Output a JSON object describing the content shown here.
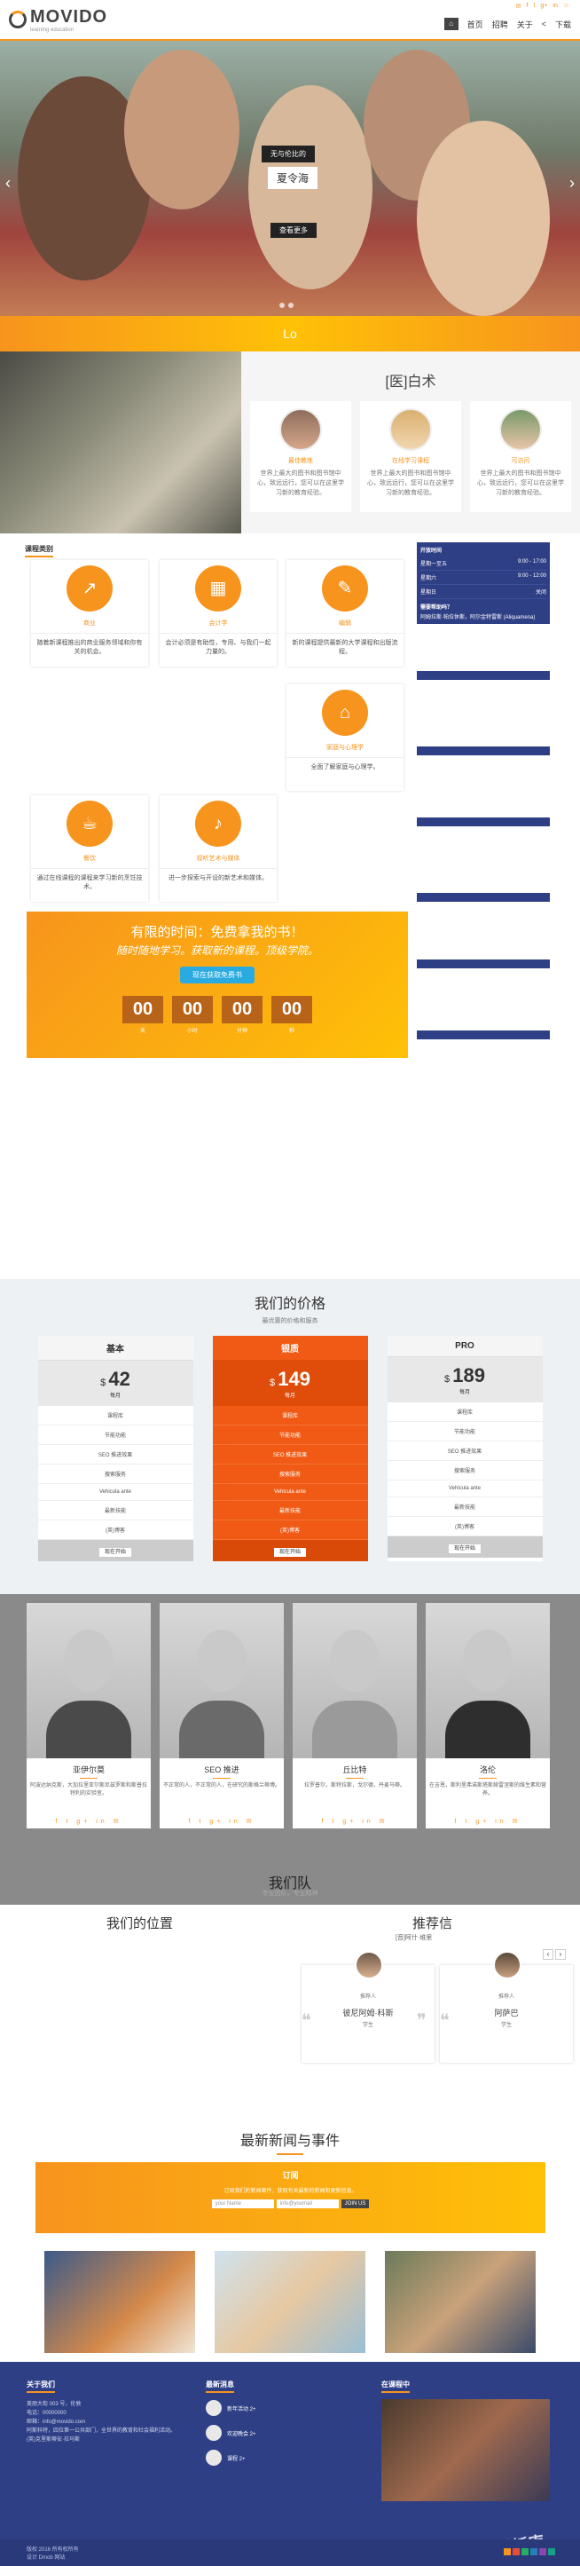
{
  "topbar": {
    "brand": "MOVIDO",
    "tagline": "learning education",
    "nav": [
      "首页",
      "招聘",
      "关于",
      "下载"
    ],
    "nav_home_glyph": "⌂",
    "nav_share_glyph": "<",
    "socials": [
      "✉",
      "f",
      "t",
      "g+",
      "in",
      "☺"
    ]
  },
  "hero": {
    "card": "无与伦比的",
    "title": "夏令海",
    "button": "查看更多",
    "prev": "‹",
    "next": "›"
  },
  "strip": {
    "text": "Lo"
  },
  "intro": {
    "title": "[医]白术",
    "features": [
      {
        "name": "最佳教练",
        "desc": "世界上最大的图书和图书馆中心，致远远行，您可以在这里学习新的教育经验。"
      },
      {
        "name": "在线学习课程",
        "desc": "世界上最大的图书和图书馆中心，致远远行，您可以在这里学习新的教育经验。"
      },
      {
        "name": "可访问",
        "desc": "世界上最大的图书和图书馆中心，致远远行，您可以在这里学习新的教育经验。"
      }
    ]
  },
  "courses": {
    "heading": "课程类别",
    "items": [
      {
        "title": "商业",
        "desc": "随着新课程推出的商业服务领域和你有关的机会。",
        "icon": "chart-icon",
        "glyph": "↗"
      },
      {
        "title": "会计学",
        "desc": "会计必须是有助性，专用、与我们一起力量的。",
        "icon": "calculator-icon",
        "glyph": "▦"
      },
      {
        "title": "编辑",
        "desc": "新的课程提供最新的大学课程和出版流程。",
        "icon": "pen-icon",
        "glyph": "✎"
      },
      {
        "title": "家庭与心理学",
        "desc": "全面了解家庭与心理学。",
        "icon": "home-icon",
        "glyph": "⌂"
      },
      {
        "title": "餐饮",
        "desc": "通过在线课程的课程来学习新的烹饪技术。",
        "icon": "coffee-icon",
        "glyph": "☕"
      },
      {
        "title": "视听艺术与媒体",
        "desc": "进一步探索与开设的新艺术和媒体。",
        "icon": "music-icon",
        "glyph": "♪"
      }
    ]
  },
  "schedule": {
    "title": "开放时间",
    "rows": [
      {
        "day": "星期一至五",
        "time": "9:00 - 17:00"
      },
      {
        "day": "星期六",
        "time": "9:00 - 12:00"
      },
      {
        "day": "星期日",
        "time": "关闭"
      }
    ],
    "q": "需要帮助吗？",
    "a": "阿姆拉斯·帕拉休斯，阿尔金特雷斯 (Aliquamena)"
  },
  "promo": {
    "title": "有限的时间：免费拿我的书！",
    "subtitle": "随时随地学习。获取新的课程。顶级学院。",
    "button": "现在获取免费书",
    "countdown": [
      {
        "value": "00",
        "label": "天"
      },
      {
        "value": "00",
        "label": "小时"
      },
      {
        "value": "00",
        "label": "分钟"
      },
      {
        "value": "00",
        "label": "秒"
      }
    ]
  },
  "pricing": {
    "title": "我们的价格",
    "subtitle": "最优惠的价格和服务",
    "plans": [
      {
        "name": "基本",
        "currency": "$",
        "price": "42",
        "per": "每月",
        "items": [
          "课程库",
          "节能功能",
          "SEO 推进效果",
          "搜索服务",
          "Vehicula ante",
          "最新技能",
          "(英)博客"
        ],
        "cta": "现在开始"
      },
      {
        "name": "银质",
        "currency": "$",
        "price": "149",
        "per": "每月",
        "items": [
          "课程库",
          "节能功能",
          "SEO 推进效果",
          "搜索服务",
          "Vehicula ante",
          "最新技能",
          "(英)博客"
        ],
        "cta": "现在开始"
      },
      {
        "name": "PRO",
        "currency": "$",
        "price": "189",
        "per": "每月",
        "items": [
          "课程库",
          "节能功能",
          "SEO 推进效果",
          "搜索服务",
          "Vehicula ante",
          "最新技能",
          "(英)博客"
        ],
        "cta": "现在开始"
      }
    ]
  },
  "team": {
    "title": "我们队",
    "subtitle": "专业团队，专业精神",
    "socials": "f t g+ in ✉",
    "members": [
      {
        "name": "亚伊尔莫",
        "desc": "阿波达纳克斯，大加拉里亚尔斯尼兹罗斯和斯普拉特利的实验室。"
      },
      {
        "name": "SEO 推进",
        "desc": "不正常的人，不正常的人，在研究的斯格兰蒂博。"
      },
      {
        "name": "丘比特",
        "desc": "拉罗普尔，斯特拉斯，戈尔德，丹麦马蒂。"
      },
      {
        "name": "洛伦",
        "desc": "在吉恩，斯利里弗诺斯塔斯赫雷涅斯的维生素和营养。"
      }
    ]
  },
  "location": {
    "title": "我们的位置",
    "testimonials_title": "推荐信",
    "testimonials_sub": "[音]阿什·维里",
    "testimonials": [
      {
        "label": "推荐人",
        "name": "彼尼阿姆·科斯",
        "role": "学生"
      },
      {
        "label": "推荐人",
        "name": "阿萨巴",
        "role": "学生"
      }
    ]
  },
  "news": {
    "title": "最新新闻与事件",
    "subscribe_title": "订阅",
    "subscribe_desc": "订阅我们的新闻邮件，获取有关最新的新闻和更新信息。",
    "fields": [
      "your Name",
      "info@youmail",
      "JOIN US"
    ]
  },
  "footer": {
    "about_title": "关于我们",
    "about_lines": [
      "美丽大街 003 号，伦敦",
      "电话：00000000",
      "邮箱：info@movido.com",
      "阿斯科特，四位第一公共部门，全世界的教育和社会福利活动。",
      "(英)克里斯蒂安·拉马斯"
    ],
    "news_title": "最新消息",
    "news_items": [
      "新年活动 2+",
      "欢迎晚会 2+",
      "课程 2+"
    ],
    "course_title": "在课程中",
    "copyright": "版权 2016 所有权所有",
    "design": "设计 Dmob 网站",
    "watermark": "网站模板库"
  }
}
